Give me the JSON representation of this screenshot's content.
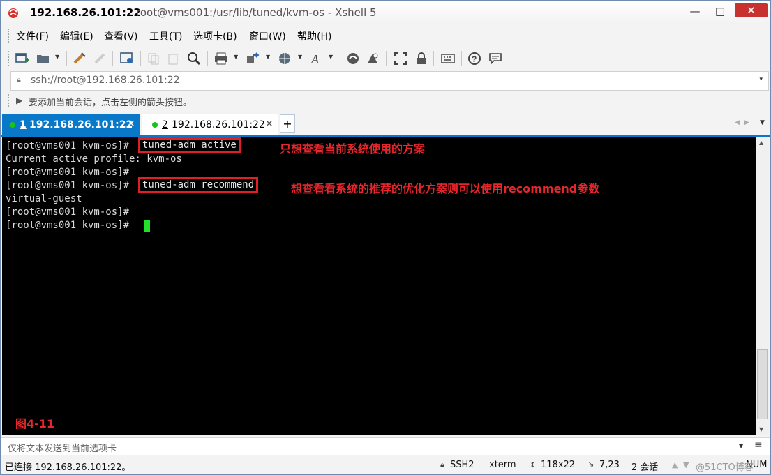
{
  "window": {
    "host_title": "192.168.26.101:22",
    "path_title": "root@vms001:/usr/lib/tuned/kvm-os - Xshell 5",
    "minimize": "—",
    "maximize": "□",
    "close": "✕"
  },
  "menu": [
    "文件(F)",
    "编辑(E)",
    "查看(V)",
    "工具(T)",
    "选项卡(B)",
    "窗口(W)",
    "帮助(H)"
  ],
  "address": {
    "value": "ssh://root@192.168.26.101:22",
    "dropdown": "▾"
  },
  "hint": "要添加当前会话，点击左侧的箭头按钮。",
  "tabs": [
    {
      "number": "1",
      "label": "192.168.26.101:22",
      "close": "✕",
      "active": true
    },
    {
      "number": "2",
      "label": "192.168.26.101:22",
      "close": "✕",
      "active": false
    }
  ],
  "tab_add": "+",
  "terminal": {
    "lines": [
      {
        "prompt": "[root@vms001 kvm-os]#",
        "command": "tuned-adm active"
      },
      {
        "output": "Current active profile: kvm-os"
      },
      {
        "prompt": "[root@vms001 kvm-os]#"
      },
      {
        "prompt": "[root@vms001 kvm-os]#",
        "command": "tuned-adm recommend"
      },
      {
        "output": "virtual-guest"
      },
      {
        "prompt": "[root@vms001 kvm-os]#"
      },
      {
        "prompt": "[root@vms001 kvm-os]#"
      }
    ],
    "annotations": [
      "只想查看当前系统使用的方案",
      "想查看看系统的推荐的优化方案则可以使用recommend参数"
    ],
    "figure_label": "图4-11"
  },
  "sendbar": {
    "placeholder": "仅将文本发送到当前选项卡"
  },
  "status": {
    "connection": "已连接 192.168.26.101:22。",
    "protocol": "SSH2",
    "terminal_type": "xterm",
    "size": "118x22",
    "cursor_pos": "7,23",
    "sessions": "2 会话",
    "mode": "NUM",
    "watermark": "@51CTO博客"
  },
  "colors": {
    "accent": "#0a78c8",
    "annotation": "#e8262c",
    "cursor": "#22e02a",
    "online_dot": "#18c418"
  }
}
